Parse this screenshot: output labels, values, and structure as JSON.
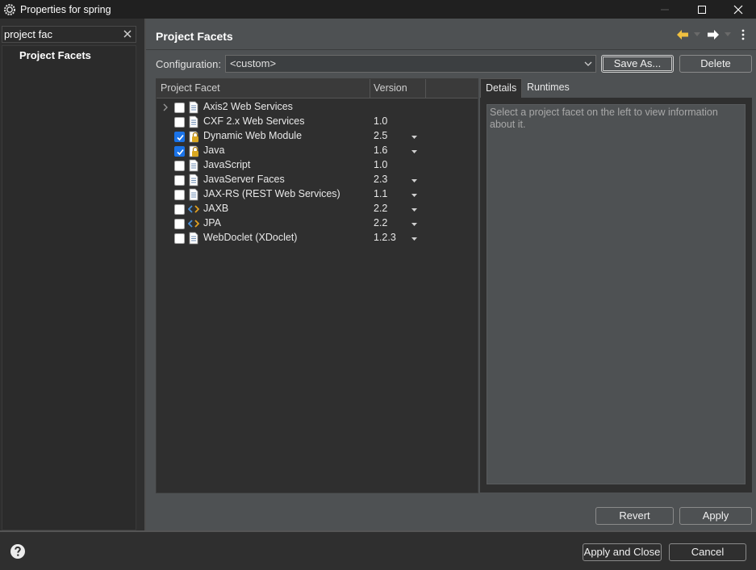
{
  "window": {
    "title": "Properties for spring",
    "icon": "eclipse-gear-icon",
    "controls": [
      "minimize-icon",
      "maximize-icon",
      "close-icon"
    ]
  },
  "sidebar": {
    "search_value": "project fac",
    "items": [
      {
        "label": "Project Facets",
        "selected": true
      }
    ]
  },
  "page": {
    "title": "Project Facets",
    "nav_icons": [
      "back-arrow-icon",
      "forward-arrow-icon",
      "more-menu-icon"
    ]
  },
  "configuration": {
    "label": "Configuration:",
    "value": "<custom>",
    "save_as_label": "Save As...",
    "delete_label": "Delete"
  },
  "facets": {
    "columns": [
      "Project Facet",
      "Version"
    ],
    "rows": [
      {
        "name": "Axis2 Web Services",
        "version": "",
        "checked": false,
        "expandable": true,
        "icon": "document-icon",
        "has_dropdown": false
      },
      {
        "name": "CXF 2.x Web Services",
        "version": "1.0",
        "checked": false,
        "expandable": false,
        "icon": "document-icon",
        "has_dropdown": false
      },
      {
        "name": "Dynamic Web Module",
        "version": "2.5",
        "checked": true,
        "expandable": false,
        "icon": "locked-facet-icon",
        "has_dropdown": true
      },
      {
        "name": "Java",
        "version": "1.6",
        "checked": true,
        "expandable": false,
        "icon": "locked-facet-icon",
        "has_dropdown": true
      },
      {
        "name": "JavaScript",
        "version": "1.0",
        "checked": false,
        "expandable": false,
        "icon": "document-icon",
        "has_dropdown": false
      },
      {
        "name": "JavaServer Faces",
        "version": "2.3",
        "checked": false,
        "expandable": false,
        "icon": "document-icon",
        "has_dropdown": true
      },
      {
        "name": "JAX-RS (REST Web Services)",
        "version": "1.1",
        "checked": false,
        "expandable": false,
        "icon": "document-icon",
        "has_dropdown": true
      },
      {
        "name": "JAXB",
        "version": "2.2",
        "checked": false,
        "expandable": false,
        "icon": "code-arrows-icon",
        "has_dropdown": true
      },
      {
        "name": "JPA",
        "version": "2.2",
        "checked": false,
        "expandable": false,
        "icon": "code-arrows-icon",
        "has_dropdown": true
      },
      {
        "name": "WebDoclet (XDoclet)",
        "version": "1.2.3",
        "checked": false,
        "expandable": false,
        "icon": "document-icon",
        "has_dropdown": true
      }
    ]
  },
  "details": {
    "tabs": [
      "Details",
      "Runtimes"
    ],
    "active_tab": "Details",
    "placeholder": "Select a project facet on the left to view information about it."
  },
  "actions": {
    "revert_label": "Revert",
    "apply_label": "Apply"
  },
  "footer": {
    "help_icon": "help-icon",
    "apply_close_label": "Apply and Close",
    "cancel_label": "Cancel"
  },
  "colors": {
    "titlebar_bg": "#202020",
    "panel_bg": "#4e5153",
    "dark_bg": "#2f2f2f",
    "checkbox_checked": "#1a73e8",
    "nav_arrow": "#f0c040"
  }
}
